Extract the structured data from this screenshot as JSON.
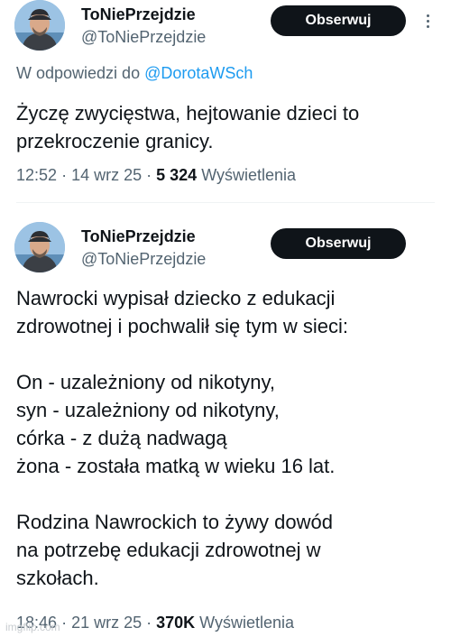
{
  "tweet1": {
    "display_name": "ToNiePrzejdzie",
    "handle": "@ToNiePrzejdzie",
    "follow_label": "Obserwuj",
    "reply_prefix": "W odpowiedzi do",
    "reply_mention": "@DorotaWSch",
    "text": "Życzę zwycięstwa, hejtowanie dzieci to\nprzekroczenie granicy.",
    "time": "12:52",
    "date": "14 wrz 25",
    "views_count": "5 324",
    "views_label": "Wyświetlenia"
  },
  "tweet2": {
    "display_name": "ToNiePrzejdzie",
    "handle": "@ToNiePrzejdzie",
    "follow_label": "Obserwuj",
    "text": "Nawrocki wypisał dziecko z edukacji\nzdrowotnej i pochwalił się tym w sieci:\n\nOn - uzależniony od nikotyny,\nsyn - uzależniony od nikotyny,\ncórka - z dużą nadwagą\nżona - została matką w wieku 16 lat.\n\nRodzina Nawrockich to żywy dowód\nna potrzebę edukacji zdrowotnej w\nszkołach.",
    "time": "18:46",
    "date": "21 wrz 25",
    "views_count": "370K",
    "views_label": "Wyświetlenia"
  },
  "watermark": "imgflip.com",
  "icons": {
    "more": "more-options-icon",
    "avatar": "profile-avatar"
  },
  "colors": {
    "link": "#1d9bf0",
    "secondary_text": "#536471",
    "button_bg": "#0f1419"
  }
}
